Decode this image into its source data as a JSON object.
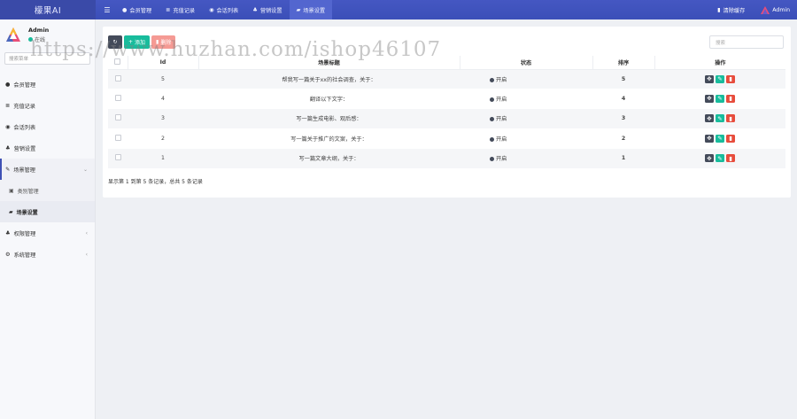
{
  "app": {
    "brand": "檬果AI"
  },
  "topnav": {
    "items": [
      {
        "label": "会员管理",
        "icon": "user-icon"
      },
      {
        "label": "充值记录",
        "icon": "database-icon"
      },
      {
        "label": "会话列表",
        "icon": "comment-icon"
      },
      {
        "label": "营销设置",
        "icon": "users-icon"
      },
      {
        "label": "场景设置",
        "icon": "book-icon",
        "active": true
      }
    ],
    "clear_cache": "清除缓存",
    "user": "Admin"
  },
  "sidebar": {
    "user": {
      "name": "Admin",
      "status": "在线"
    },
    "search_placeholder": "搜索菜单",
    "menu": [
      {
        "label": "会员管理",
        "icon": "user-icon"
      },
      {
        "label": "充值记录",
        "icon": "database-icon"
      },
      {
        "label": "会话列表",
        "icon": "comment-icon"
      },
      {
        "label": "营销设置",
        "icon": "users-icon"
      },
      {
        "label": "场景管理",
        "icon": "magic-icon",
        "open": true,
        "caret": "⌄"
      },
      {
        "label": "类别管理",
        "icon": "image-icon",
        "sub": true
      },
      {
        "label": "场景设置",
        "icon": "book-icon",
        "sub": true,
        "current": true
      },
      {
        "label": "权限管理",
        "icon": "group-icon",
        "caret": "‹"
      },
      {
        "label": "系统管理",
        "icon": "cogs-icon",
        "caret": "‹"
      }
    ]
  },
  "toolbar": {
    "add_label": "添加",
    "delete_label": "删除"
  },
  "search": {
    "placeholder": "搜索"
  },
  "table": {
    "columns": [
      "Id",
      "场景标题",
      "状态",
      "排序",
      "操作"
    ],
    "rows": [
      {
        "id": "5",
        "title": "帮我写一篇关于xx的社会调查，关于：",
        "status": "开启",
        "sort": "5"
      },
      {
        "id": "4",
        "title": "翻译以下文字：",
        "status": "开启",
        "sort": "4"
      },
      {
        "id": "3",
        "title": "写一篇生成电影、观后感：",
        "status": "开启",
        "sort": "3"
      },
      {
        "id": "2",
        "title": "写一篇关于推广的文案，关于：",
        "status": "开启",
        "sort": "2"
      },
      {
        "id": "1",
        "title": "写一篇文章大纲，关于：",
        "status": "开启",
        "sort": "1"
      }
    ]
  },
  "pager": {
    "text": "显示第 1 到第 5 条记录，总共 5 条记录"
  },
  "colors": {
    "primary": "#3f51b5",
    "success": "#18bc9c",
    "danger": "#e74c3c",
    "dark": "#444b5a"
  },
  "watermark": "https://www.huzhan.com/ishop46107"
}
